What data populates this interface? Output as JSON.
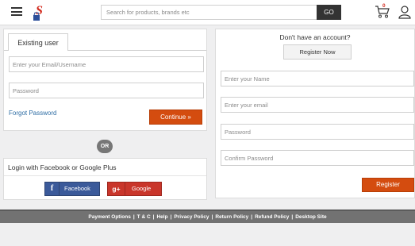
{
  "header": {
    "search_placeholder": "Search for products, brands etc",
    "go_label": "GO",
    "cart_count": "0",
    "logo_letter": "S"
  },
  "login": {
    "tab_label": "Existing user",
    "email_placeholder": "Enter your Email/Username",
    "password_placeholder": "Password",
    "forgot_label": "Forgot Password",
    "continue_label": "Continue »"
  },
  "or_label": "OR",
  "social": {
    "title": "Login with Facebook or Google Plus",
    "facebook_label": "Facebook",
    "facebook_glyph": "f",
    "google_label": "Google",
    "google_glyph": "g+"
  },
  "register": {
    "prompt": "Don't have an account?",
    "register_now_label": "Register Now",
    "name_placeholder": "Enter your Name",
    "email_placeholder": "Enter your email",
    "password_placeholder": "Password",
    "confirm_placeholder": "Confirm Password",
    "register_label": "Register"
  },
  "footer": {
    "links": [
      "Payment Options",
      "T & C",
      "Help",
      "Privacy Policy",
      "Return Policy",
      "Refund Policy",
      "Desktop Site"
    ],
    "separator": "|"
  },
  "colors": {
    "accent": "#d44c0f",
    "facebook": "#3b5a9a",
    "google": "#c9362b",
    "footer": "#727272"
  }
}
